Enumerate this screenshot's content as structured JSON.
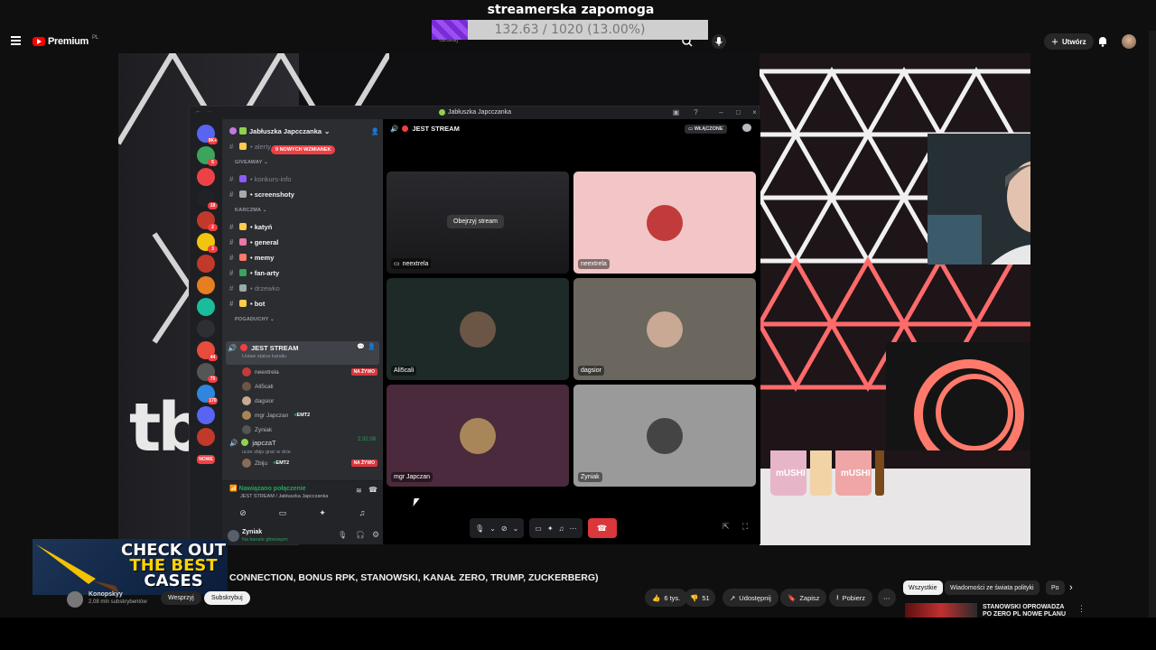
{
  "overlay": {
    "title": "streamerska zapomoga",
    "progress_text": "132.63 / 1020 (13.00%)",
    "progress_fraction": 0.13
  },
  "masthead": {
    "brand": "Premium",
    "region": "PL",
    "search_placeholder": "Szukaj",
    "create_label": "Utwórz"
  },
  "discord": {
    "window_title": "Jabłuszka Japcczanka",
    "guild_name": "Jabłuszka Japcczanka",
    "mention_pill": "9 NOWYCH WZMIANEK",
    "servers": [
      {
        "badge": "9K+",
        "color": "#5865f2"
      },
      {
        "badge": "5",
        "color": "#3ba55c"
      },
      {
        "badge": "",
        "color": "#ed4245"
      },
      {
        "badge": "19",
        "color": "#202225"
      },
      {
        "badge": "2",
        "color": "#c0392b"
      },
      {
        "badge": "3",
        "color": "#f1c40f"
      },
      {
        "badge": "",
        "color": "#c0392b"
      },
      {
        "badge": "",
        "color": "#e67e22"
      },
      {
        "badge": "",
        "color": "#1abc9c"
      },
      {
        "badge": "",
        "color": "#2c2f33"
      },
      {
        "badge": "44",
        "color": "#e74c3c"
      },
      {
        "badge": "75",
        "color": "#555"
      },
      {
        "badge": "170",
        "color": "#2e86de"
      },
      {
        "badge": "",
        "color": "#5865f2"
      },
      {
        "badge": "",
        "color": "#c0392b"
      },
      {
        "badge": "NOWE",
        "color": "#2b2d31"
      }
    ],
    "channels_top": [
      {
        "name": "alerty",
        "muted": true
      },
      {
        "category": "GIVEAWAY"
      },
      {
        "name": "konkurs-info",
        "muted": true
      },
      {
        "name": "screenshoty",
        "muted": false
      },
      {
        "category": "KARCZMA"
      },
      {
        "name": "katyń",
        "muted": false
      },
      {
        "name": "general",
        "muted": false
      },
      {
        "name": "memy",
        "muted": false
      },
      {
        "name": "fan-arty",
        "muted": false
      },
      {
        "name": "drzewko",
        "muted": true
      },
      {
        "name": "bot",
        "muted": false
      },
      {
        "category": "POGADUCHY"
      }
    ],
    "voice_channel": {
      "name": "JEST STREAM",
      "status_hint": "Ustaw status kanału",
      "live_tag": "NA ŻYWO",
      "users": [
        "neextrela",
        "Ali5cali",
        "dagsior",
        "mgr Japczan",
        "Zyniak"
      ],
      "emt2_tag": "EMT2"
    },
    "voice_channel_2": {
      "name": "japczaT",
      "timer": "2:32:08",
      "subtitle": "ucze zbiju grać w dcie",
      "user": "Zbiju",
      "user_tag": "EMT2",
      "live_tag": "NA ŻYWO"
    },
    "connection": {
      "status": "Nawiązano połączenie",
      "location": "JEST STREAM / Jabłuszka Japcczanka"
    },
    "user_panel": {
      "name": "Zyniak",
      "status": "Na kanale głosowym"
    },
    "stage": {
      "channel_name": "JEST STREAM",
      "badge": "WŁĄCZONE",
      "watch_button": "Obejrzyj stream",
      "tiles": [
        {
          "name": "neextrela",
          "bg": "#1e1f22",
          "face": "#2b2d31",
          "stream": true
        },
        {
          "name": "neextrela",
          "bg": "#f2c6c7",
          "face": "#c23b3b",
          "stream": false
        },
        {
          "name": "Ali5cali",
          "bg": "#1e2a28",
          "face": "#6b5645",
          "stream": false
        },
        {
          "name": "dagsior",
          "bg": "#6b675e",
          "face": "#c9a994",
          "stream": false
        },
        {
          "name": "mgr Japczan",
          "bg": "#4a2a3c",
          "face": "#a8865a",
          "stream": false
        },
        {
          "name": "Zyniak",
          "bg": "#9a9a9a",
          "face": "#444",
          "stream": false
        }
      ]
    }
  },
  "ad": {
    "line1": "CHECK OUT",
    "line2": "THE BEST",
    "line3": "CASES"
  },
  "video_info": {
    "title": "CONNECTION, BONUS RPK, STANOWSKI, KANAŁ ZERO, TRUMP, ZUCKERBERG)",
    "channel_name": "Konopskyy",
    "channel_subs": "2,08 mln subskrybentów",
    "support_label": "Wesprzyj",
    "subscribe_label": "Subskrybuj",
    "likes": "6 tys.",
    "dislikes": "51",
    "share_label": "Udostępnij",
    "save_label": "Zapisz",
    "download_label": "Pobierz"
  },
  "chips": [
    "Wszystkie",
    "Wiadomości ze świata polityki",
    "Po"
  ],
  "recommended": {
    "title": "STANOWSKI OPROWADZA PO ZERO PL NOWE PLANU"
  }
}
